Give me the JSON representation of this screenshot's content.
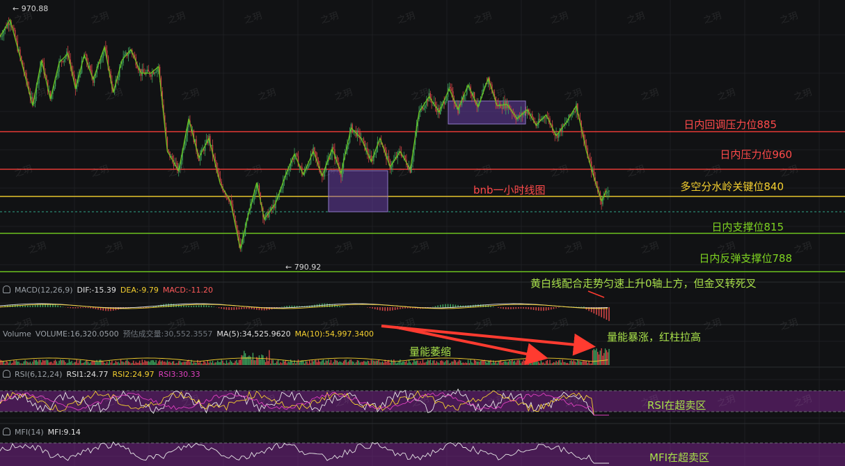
{
  "chart_data": [
    {
      "type": "candlestick",
      "title": "bnb一小时线图",
      "price_high_label": "970.88",
      "price_low_label": "790.92",
      "levels": [
        {
          "label": "日内回调压力位885",
          "value": 885,
          "color": "#e53935"
        },
        {
          "label": "日内压力位960",
          "value": 960,
          "color": "#e53935"
        },
        {
          "label": "多空分水岭关键位840",
          "value": 840,
          "color": "#e6c32d"
        },
        {
          "label": "日内支撑位815",
          "value": 815,
          "color": "#6cc21f"
        },
        {
          "label": "日内反弹支撑位788",
          "value": 788,
          "color": "#6cc21f"
        }
      ],
      "zones": [
        {
          "name": "consolidation-1"
        },
        {
          "name": "consolidation-2"
        }
      ],
      "zigzag": [
        [
          0,
          958
        ],
        [
          8,
          971
        ],
        [
          18,
          935
        ],
        [
          26,
          905
        ],
        [
          33,
          940
        ],
        [
          40,
          910
        ],
        [
          47,
          938
        ],
        [
          54,
          945
        ],
        [
          60,
          918
        ],
        [
          67,
          944
        ],
        [
          74,
          925
        ],
        [
          83,
          950
        ],
        [
          90,
          915
        ],
        [
          97,
          940
        ],
        [
          104,
          948
        ],
        [
          112,
          930
        ],
        [
          120,
          930
        ],
        [
          126,
          935
        ],
        [
          133,
          870
        ],
        [
          142,
          855
        ],
        [
          150,
          895
        ],
        [
          158,
          865
        ],
        [
          166,
          880
        ],
        [
          175,
          845
        ],
        [
          183,
          832
        ],
        [
          191,
          795
        ],
        [
          197,
          820
        ],
        [
          204,
          846
        ],
        [
          210,
          818
        ],
        [
          219,
          830
        ],
        [
          227,
          852
        ],
        [
          234,
          868
        ],
        [
          241,
          852
        ],
        [
          249,
          870
        ],
        [
          256,
          851
        ],
        [
          264,
          872
        ],
        [
          271,
          853
        ],
        [
          279,
          888
        ],
        [
          287,
          880
        ],
        [
          295,
          862
        ],
        [
          302,
          880
        ],
        [
          310,
          858
        ],
        [
          318,
          870
        ],
        [
          326,
          856
        ],
        [
          333,
          900
        ],
        [
          341,
          912
        ],
        [
          349,
          900
        ],
        [
          357,
          918
        ],
        [
          364,
          902
        ],
        [
          372,
          921
        ],
        [
          380,
          904
        ],
        [
          388,
          926
        ],
        [
          395,
          905
        ],
        [
          403,
          906
        ],
        [
          411,
          895
        ],
        [
          419,
          902
        ],
        [
          426,
          890
        ],
        [
          434,
          898
        ],
        [
          442,
          882
        ],
        [
          450,
          892
        ],
        [
          458,
          905
        ],
        [
          466,
          870
        ],
        [
          472,
          850
        ],
        [
          478,
          832
        ],
        [
          482,
          840
        ]
      ],
      "ylim": [
        775,
        985
      ]
    },
    {
      "type": "macd",
      "header": "MACD(12,26,9)",
      "dif_label": "DIF:-15.39",
      "dea_label": "DEA:-9.79",
      "macd_label": "MACD:-11.20",
      "note": "黄白线配合走势匀速上升0轴上方，但金叉转死叉"
    },
    {
      "type": "volume",
      "header": "Volume",
      "volume_label": "VOLUME:16,320.0500",
      "est_label": "预估成交量:30,552.3557",
      "ma5_label": "MA(5):34,525.9620",
      "ma10_label": "MA(10):54,997.3400",
      "note_shrink": "量能萎缩",
      "note_surge": "量能暴涨，红柱拉高"
    },
    {
      "type": "rsi",
      "header": "RSI(6,12,24)",
      "rsi1_label": "RSI1:24.77",
      "rsi2_label": "RSI2:24.97",
      "rsi3_label": "RSI3:30.33",
      "note": "RSI在超卖区"
    },
    {
      "type": "mfi",
      "header": "MFI(14)",
      "mfi_label": "MFI:9.14",
      "note": "MFI在超卖区"
    }
  ],
  "watermark": "之玥",
  "colors": {
    "bg": "#111214",
    "up": "#3da35d",
    "down": "#d24545",
    "zigzag": "#6cc21f",
    "zone_fill": "rgba(120,70,190,0.45)",
    "arrow": "#ff3b30"
  }
}
